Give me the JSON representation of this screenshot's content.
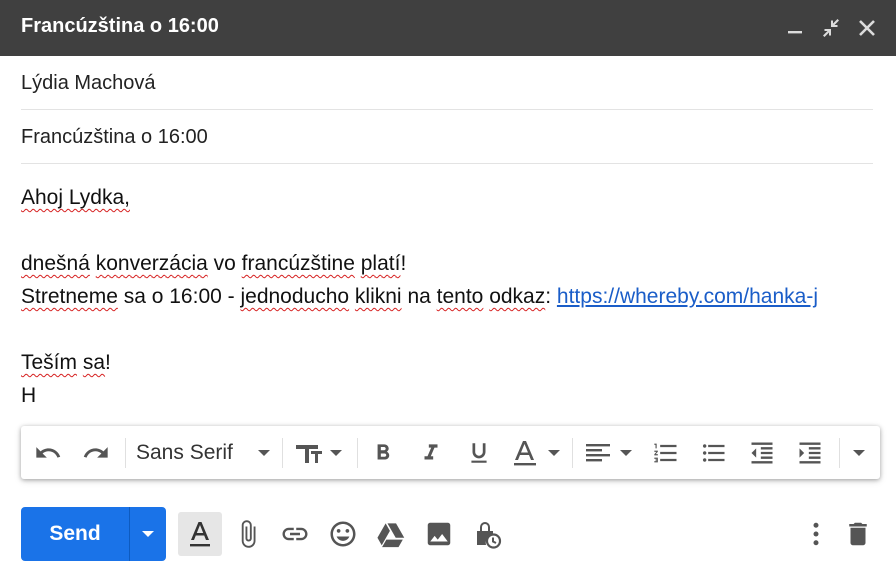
{
  "window": {
    "title": "Francúzština o 16:00",
    "minimize_icon": "minimize-icon",
    "exit_fullscreen_icon": "exit-fullscreen-icon",
    "close_icon": "close-icon"
  },
  "compose": {
    "to": "Lýdia Machová",
    "subject": "Francúzština o 16:00"
  },
  "body": {
    "greeting": "Ahoj Lydka,",
    "line2_part1": "dnešná",
    "line2_part2": "konverzácia",
    "line2_part3": " vo ",
    "line2_part4": "francúzštine",
    "line2_part5": " ",
    "line2_part6": "platí",
    "line2_part7": "!",
    "line3_part1": "Stretneme",
    "line3_part2": " sa o 16:00 - ",
    "line3_part3": "jednoducho",
    "line3_part4": "klikni",
    "line3_part5": " na ",
    "line3_part6": "tento",
    "line3_part7": "odkaz",
    "line3_part8": ": ",
    "link": "https://whereby.com/hanka-j",
    "closing_part1": "Teším",
    "closing_part2": " ",
    "closing_part3": "sa",
    "closing_part4": "!",
    "signature": "H"
  },
  "toolbar": {
    "font": "Sans Serif",
    "icons": [
      "undo-icon",
      "redo-icon",
      "font-family-dropdown",
      "font-size-icon",
      "bold-icon",
      "italic-icon",
      "underline-icon",
      "text-color-icon",
      "align-icon",
      "numbered-list-icon",
      "bulleted-list-icon",
      "indent-less-icon",
      "indent-more-icon",
      "more-formatting-icon"
    ]
  },
  "bottom": {
    "send_label": "Send",
    "icons": [
      "formatting-options-icon",
      "attach-icon",
      "link-icon",
      "emoji-icon",
      "drive-icon",
      "photo-icon",
      "confidential-mode-icon",
      "more-options-icon",
      "discard-icon"
    ]
  },
  "colors": {
    "titlebar": "#404040",
    "send_button": "#1a73e8",
    "link": "#1a5dc8",
    "spellcheck": "#d62020"
  }
}
